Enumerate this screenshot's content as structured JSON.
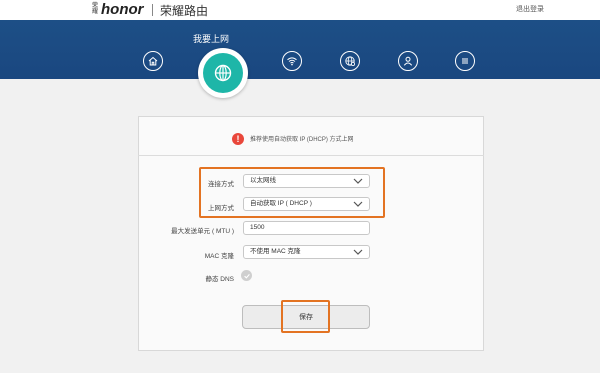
{
  "header": {
    "brand_small": "荣耀",
    "brand": "honor",
    "product": "荣耀路由",
    "logout": "退出登录"
  },
  "nav": {
    "active_title": "我要上网",
    "items": [
      {
        "name": "home",
        "icon": "home-icon"
      },
      {
        "name": "internet",
        "icon": "globe-icon",
        "active": true
      },
      {
        "name": "wifi",
        "icon": "wifi-icon"
      },
      {
        "name": "network-settings",
        "icon": "globe-gear-icon"
      },
      {
        "name": "devices",
        "icon": "user-icon"
      },
      {
        "name": "more",
        "icon": "menu-icon"
      }
    ]
  },
  "form": {
    "hint": "推荐使用自动获取 IP (DHCP) 方式上网",
    "connection_type": {
      "label": "连接方式",
      "value": "以太网线"
    },
    "internet_mode": {
      "label": "上网方式",
      "value": "自动获取 IP ( DHCP )"
    },
    "mtu": {
      "label": "最大发送单元 ( MTU )",
      "value": "1500"
    },
    "mac_clone": {
      "label": "MAC 克隆",
      "value": "不使用 MAC 克隆"
    },
    "static_dns": {
      "label": "静态 DNS"
    },
    "save_label": "保存"
  },
  "colors": {
    "nav_background": "#1d4f86",
    "active_icon": "#1eb6a8",
    "highlight": "#e37322",
    "info": "#e9473b"
  }
}
